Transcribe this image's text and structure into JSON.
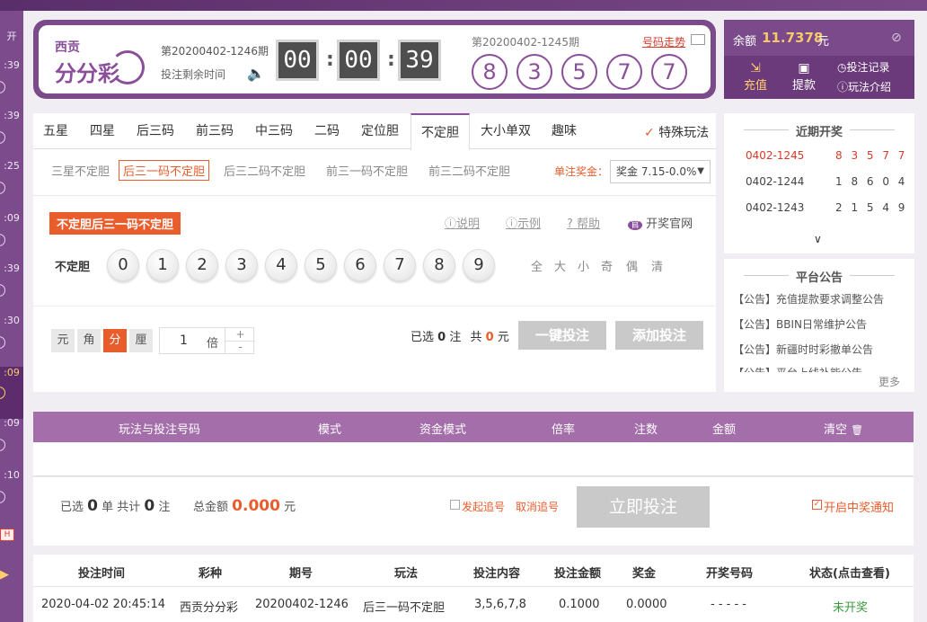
{
  "leftbar": {
    "items": [
      {
        "label": "开"
      },
      {
        "label": ":39"
      },
      {
        "label": ":39"
      },
      {
        "label": ":25"
      },
      {
        "label": ":09"
      },
      {
        "label": ":39"
      },
      {
        "label": ":30"
      },
      {
        "label": ":09"
      },
      {
        "label": ":09"
      },
      {
        "label": ":10"
      }
    ],
    "tag": "H"
  },
  "header": {
    "logo_small": "西贡",
    "logo_big": "分分彩",
    "current_period": "第20200402-1246期",
    "remaining_label": "投注剩余时间",
    "timer": [
      "00",
      "00",
      "39"
    ],
    "last_period": "第20200402-1245期",
    "trend_link": "号码走势",
    "last_balls": [
      "8",
      "3",
      "5",
      "7",
      "7"
    ]
  },
  "account": {
    "balance_label": "余额",
    "balance": "11.7378",
    "unit": "元",
    "recharge": "充值",
    "withdraw": "提款",
    "bet_records": "投注记录",
    "play_intro": "玩法介绍"
  },
  "tabs": [
    "五星",
    "四星",
    "后三码",
    "前三码",
    "中三码",
    "二码",
    "定位胆",
    "不定胆",
    "大小单双",
    "趣味"
  ],
  "special_play": "特殊玩法",
  "subtabs": [
    "三星不定胆",
    "后三一码不定胆",
    "后三二码不定胆",
    "前三一码不定胆",
    "前三二码不定胆"
  ],
  "bonus": {
    "label": "单注奖金：",
    "value": "奖金 7.15-0.0%"
  },
  "play": {
    "tag": "不定胆后三一码不定胆",
    "links": [
      "说明",
      "示例",
      "帮助"
    ],
    "official": "开奖官网",
    "row_label": "不定胆",
    "numbers": [
      "0",
      "1",
      "2",
      "3",
      "4",
      "5",
      "6",
      "7",
      "8",
      "9"
    ],
    "quick": [
      "全",
      "大",
      "小",
      "奇",
      "偶",
      "清"
    ]
  },
  "bet": {
    "units": [
      "元",
      "角",
      "分",
      "厘"
    ],
    "multiplier": "1",
    "mult_unit": "倍",
    "plus": "+",
    "minus": "-",
    "selected_prefix": "已选",
    "selected_count": "0",
    "zhu": "注",
    "total_prefix": "共",
    "total_amount": "0",
    "yuan": "元",
    "one_click": "一键投注",
    "add_bet": "添加投注"
  },
  "recent": {
    "title": "近期开奖",
    "rows": [
      {
        "period": "0402-1245",
        "nums": "8 3 5 7 7"
      },
      {
        "period": "0402-1244",
        "nums": "1 8 6 0 4"
      },
      {
        "period": "0402-1243",
        "nums": "2 1 5 4 9"
      }
    ],
    "expand": "∨"
  },
  "announce": {
    "title": "平台公告",
    "items": [
      "【公告】充值提款要求调整公告",
      "【公告】BBIN日常维护公告",
      "【公告】新疆时时彩撤单公告",
      "【公告】平台上线补能公告"
    ],
    "more": "更多"
  },
  "cart": {
    "headers": [
      "玩法与投注号码",
      "模式",
      "资金模式",
      "倍率",
      "注数",
      "金额",
      "清空"
    ]
  },
  "summary": {
    "selected": "已选",
    "orders": "0",
    "dan": "单 共计",
    "bets": "0",
    "zhu": "注",
    "total_label": "总金额",
    "total": "0.000",
    "yuan": "元",
    "chase": "发起追号",
    "cancel_chase": "取消追号",
    "submit": "立即投注",
    "notify": "开启中奖通知"
  },
  "records": {
    "headers": [
      "投注时间",
      "彩种",
      "期号",
      "玩法",
      "投注内容",
      "投注金额",
      "奖金",
      "开奖号码",
      "状态(点击查看)"
    ],
    "row": [
      "2020-04-02 20:45:14",
      "西贡分分彩",
      "20200402-1246",
      "后三一码不定胆",
      "3,5,6,7,8",
      "0.1000",
      "0.0000",
      "- - - - -",
      "未开奖"
    ]
  }
}
